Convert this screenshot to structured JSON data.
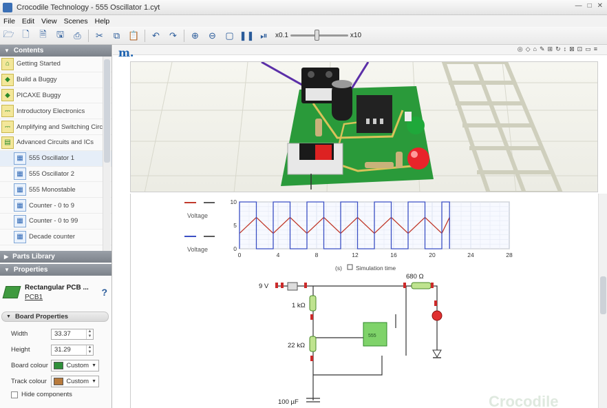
{
  "window": {
    "title": "Crocodile Technology - 555 Oscillator 1.cyt",
    "controls": [
      "—",
      "□",
      "✕"
    ]
  },
  "menu": [
    "File",
    "Edit",
    "View",
    "Scenes",
    "Help"
  ],
  "toolbar": {
    "icons": [
      "open-folder-icon",
      "new-file-icon",
      "open-file-icon",
      "save-icon",
      "print-icon",
      "cut-icon",
      "copy-icon",
      "paste-icon",
      "undo-icon",
      "redo-icon",
      "zoom-in-icon",
      "zoom-out-icon",
      "select-icon",
      "pause-icon",
      "step-icon"
    ],
    "speed_min": "x0.1",
    "speed_max": "x10",
    "speed_level": 0.45
  },
  "sidebar": {
    "contents_header": "Contents",
    "items": [
      {
        "label": "Getting Started",
        "icon": "house-icon",
        "sub": false
      },
      {
        "label": "Build a Buggy",
        "icon": "buggy-icon",
        "sub": false
      },
      {
        "label": "PICAXE Buggy",
        "icon": "buggy-icon",
        "sub": false
      },
      {
        "label": "Introductory Electronics",
        "icon": "circuit-icon",
        "sub": false
      },
      {
        "label": "Amplifying and Switching Circ",
        "icon": "circuit-icon",
        "sub": false
      },
      {
        "label": "Advanced Circuits and ICs",
        "icon": "folder-open-icon",
        "sub": false
      },
      {
        "label": "555 Oscillator 1",
        "icon": "page-icon",
        "sub": true,
        "selected": true
      },
      {
        "label": "555 Oscillator 2",
        "icon": "page-icon",
        "sub": true
      },
      {
        "label": "555 Monostable",
        "icon": "page-icon",
        "sub": true
      },
      {
        "label": "Counter - 0 to 9",
        "icon": "page-icon",
        "sub": true
      },
      {
        "label": "Counter - 0 to 99",
        "icon": "page-icon",
        "sub": true
      },
      {
        "label": "Decade counter",
        "icon": "page-icon",
        "sub": true
      }
    ],
    "parts_header": "Parts Library",
    "properties_header": "Properties",
    "component": {
      "name": "Rectangular PCB ...",
      "id": "PCB1",
      "help": "?"
    },
    "board_header": "Board Properties",
    "width": {
      "label": "Width",
      "value": "33.37"
    },
    "height": {
      "label": "Height",
      "value": "31.29"
    },
    "board_colour": {
      "label": "Board colour",
      "value": "Custom",
      "swatch": "#2f8f3a"
    },
    "track_colour": {
      "label": "Track colour",
      "value": "Custom",
      "swatch": "#b87a3c"
    },
    "hide_components": "Hide components"
  },
  "main": {
    "brand_mark": "m.",
    "view_tools": [
      "◎",
      "◇",
      "⌂",
      "✎",
      "⊞",
      "↻",
      "↕",
      "⊠",
      "⊡",
      "▭",
      "≡"
    ]
  },
  "colors": {
    "pcb_green": "#2a9a3a",
    "track_yellow": "#d9c25a",
    "led_red": "#e8242a",
    "led_green": "#1fa83a",
    "wire_purple": "#5b2fa8",
    "signal_blue": "#3b4fc4",
    "signal_red": "#c0392b"
  },
  "chart_data": {
    "type": "line",
    "series": [
      {
        "name": "Voltage",
        "color": "#c0392b",
        "style": "triangle",
        "period": 3.5,
        "ymin": 3.3,
        "ymax": 6.7,
        "x_end": 21.8
      },
      {
        "name": "Voltage",
        "color": "#3b4fc4",
        "style": "square",
        "period": 3.5,
        "ymin": 0,
        "ymax": 10,
        "duty": 0.5,
        "x_end": 21.8
      }
    ],
    "xlim": [
      0,
      28
    ],
    "ylim": [
      0,
      10
    ],
    "xticks": [
      0,
      4,
      8,
      12,
      16,
      20,
      24,
      28
    ],
    "yticks": [
      0,
      5,
      10
    ],
    "xlabel": "Simulation time",
    "xunit": "(s)",
    "grid": true
  },
  "schematic": {
    "supply": "9 V",
    "r1": "1 kΩ",
    "r2": "22 kΩ",
    "r3": "680 Ω",
    "c1": "100 µF",
    "ic": "555",
    "watermark": "Crocodile"
  }
}
